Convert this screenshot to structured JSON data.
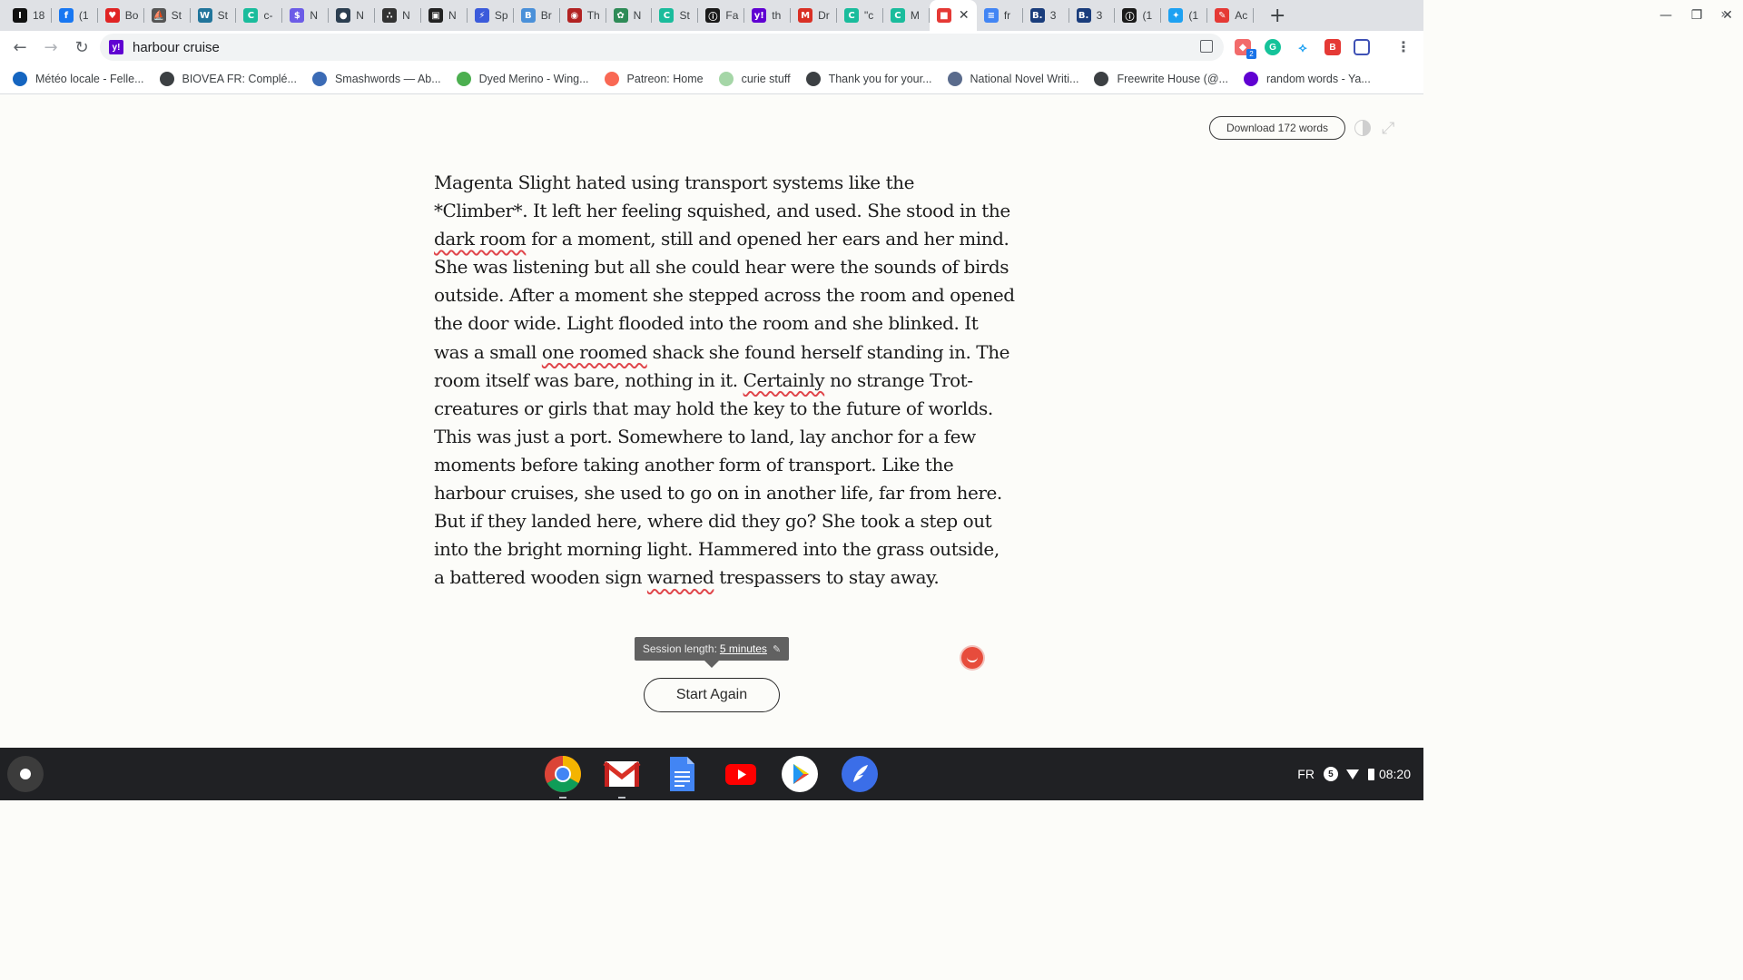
{
  "browser": {
    "tabs": [
      {
        "title": "18",
        "icon": "bookmark-i-icon",
        "color": "#111111",
        "glyph": "I"
      },
      {
        "title": "(1",
        "icon": "facebook-icon",
        "color": "#1877f2",
        "glyph": "f"
      },
      {
        "title": "Bo",
        "icon": "heart-icon",
        "color": "#e02424",
        "glyph": "♥"
      },
      {
        "title": "St",
        "icon": "ship-icon",
        "color": "#555555",
        "glyph": "⛵"
      },
      {
        "title": "St",
        "icon": "wordpress-icon",
        "color": "#21759b",
        "glyph": "W"
      },
      {
        "title": "c-",
        "icon": "circle-green-icon",
        "color": "#1abc9c",
        "glyph": "C"
      },
      {
        "title": "N",
        "icon": "dollar-icon",
        "color": "#6c5ce7",
        "glyph": "$"
      },
      {
        "title": "N",
        "icon": "globe-icon",
        "color": "#2c3e50",
        "glyph": "●"
      },
      {
        "title": "N",
        "icon": "dots-icon",
        "color": "#333333",
        "glyph": "∴"
      },
      {
        "title": "N",
        "icon": "book-icon",
        "color": "#222222",
        "glyph": "▣"
      },
      {
        "title": "Sp",
        "icon": "bolt-icon",
        "color": "#3b5bdb",
        "glyph": "⚡"
      },
      {
        "title": "Br",
        "icon": "bubble-icon",
        "color": "#4a90d9",
        "glyph": "B"
      },
      {
        "title": "Th",
        "icon": "shield-icon",
        "color": "#b22222",
        "glyph": "◉"
      },
      {
        "title": "N",
        "icon": "leaf-icon",
        "color": "#2e8b57",
        "glyph": "✿"
      },
      {
        "title": "St",
        "icon": "circle-green-icon",
        "color": "#1abc9c",
        "glyph": "C"
      },
      {
        "title": "Fa",
        "icon": "medium-icon",
        "color": "#1a1a1a",
        "glyph": "ⓘ"
      },
      {
        "title": "th",
        "icon": "yahoo-icon",
        "color": "#6001d2",
        "glyph": "y!"
      },
      {
        "title": "Dr",
        "icon": "gmail-icon",
        "color": "#d93025",
        "glyph": "M"
      },
      {
        "title": "\"c",
        "icon": "circle-green-icon",
        "color": "#1abc9c",
        "glyph": "C"
      },
      {
        "title": "M",
        "icon": "circle-green-icon",
        "color": "#1abc9c",
        "glyph": "C"
      },
      {
        "title": "",
        "icon": "red-square-icon",
        "color": "#e53935",
        "glyph": "■",
        "active": true
      },
      {
        "title": "fr",
        "icon": "docs-icon",
        "color": "#4285f4",
        "glyph": "≡"
      },
      {
        "title": "3",
        "icon": "b-icon",
        "color": "#1a3d7c",
        "glyph": "B."
      },
      {
        "title": "3",
        "icon": "b-icon",
        "color": "#1a3d7c",
        "glyph": "B."
      },
      {
        "title": "(1",
        "icon": "medium-icon",
        "color": "#1a1a1a",
        "glyph": "ⓘ"
      },
      {
        "title": "(1",
        "icon": "twitter-icon",
        "color": "#1da1f2",
        "glyph": "✦"
      },
      {
        "title": "Ac",
        "icon": "pen-icon",
        "color": "#e53935",
        "glyph": "✎"
      }
    ],
    "address": "harbour cruise",
    "bookmarks": [
      {
        "label": "Météo locale - Felle...",
        "color": "#1565c0",
        "icon": "weather-icon"
      },
      {
        "label": "BIOVEA FR: Complé...",
        "color": "#3c4043",
        "icon": "globe-icon"
      },
      {
        "label": "Smashwords — Ab...",
        "color": "#3b6bb5",
        "icon": "smashwords-icon"
      },
      {
        "label": "Dyed Merino - Wing...",
        "color": "#4caf50",
        "icon": "w-icon"
      },
      {
        "label": "Patreon: Home",
        "color": "#f96854",
        "icon": "patreon-icon"
      },
      {
        "label": "curie stuff",
        "color": "#a5d6a7",
        "icon": "curie-icon"
      },
      {
        "label": "Thank you for your...",
        "color": "#3c4043",
        "icon": "globe-icon"
      },
      {
        "label": "National Novel Writi...",
        "color": "#5a6b8c",
        "icon": "nanowrimo-icon"
      },
      {
        "label": "Freewrite House (@...",
        "color": "#3c4043",
        "icon": "globe-icon"
      },
      {
        "label": "random words - Ya...",
        "color": "#6001d2",
        "icon": "yahoo-icon"
      }
    ]
  },
  "app": {
    "download_label": "Download 172 words",
    "story_lines": [
      [
        {
          "t": "Magenta Slight hated using transport systems like the"
        }
      ],
      [
        {
          "t": "*Climber*. It left her feeling squished, and used. She stood in the"
        }
      ],
      [
        {
          "t": "dark room",
          "sp": true
        },
        {
          "t": " for a moment, still and opened her ears and her mind."
        }
      ],
      [
        {
          "t": "She was listening but all she could hear were the sounds of birds"
        }
      ],
      [
        {
          "t": "outside. After a moment she stepped across the room and opened"
        }
      ],
      [
        {
          "t": "the door wide. Light flooded into the room and she blinked. It"
        }
      ],
      [
        {
          "t": "was a small "
        },
        {
          "t": "one roomed",
          "sp": true
        },
        {
          "t": " shack she found herself standing in. The"
        }
      ],
      [
        {
          "t": "room itself was bare, nothing in it. "
        },
        {
          "t": "Certainly",
          "sp": true
        },
        {
          "t": " no strange Trot-"
        }
      ],
      [
        {
          "t": "creatures or girls that may hold the key to the future of worlds."
        }
      ],
      [
        {
          "t": "This was just a port. Somewhere to land, lay anchor for a few"
        }
      ],
      [
        {
          "t": "moments before taking another form of transport. Like the"
        }
      ],
      [
        {
          "t": "harbour cruises, she used to go on in another life, far from here."
        }
      ],
      [
        {
          "t": "But if they landed here, where did they go? She took a step out"
        }
      ],
      [
        {
          "t": "into the bright morning light. Hammered into the grass outside,"
        }
      ],
      [
        {
          "t": "a battered wooden sign "
        },
        {
          "t": "warned",
          "sp": true
        },
        {
          "t": " trespassers to stay away."
        }
      ]
    ],
    "session_label": "Session length:",
    "session_value": "5 minutes",
    "start_again_label": "Start Again"
  },
  "shelf": {
    "apps": [
      {
        "name": "chrome-icon",
        "running": true
      },
      {
        "name": "gmail-icon",
        "running": true
      },
      {
        "name": "docs-icon",
        "running": false
      },
      {
        "name": "youtube-icon",
        "running": false
      },
      {
        "name": "play-store-icon",
        "running": false
      },
      {
        "name": "feather-app-icon",
        "running": false
      }
    ],
    "ime": "FR",
    "notifications": "5",
    "time": "08:20"
  }
}
